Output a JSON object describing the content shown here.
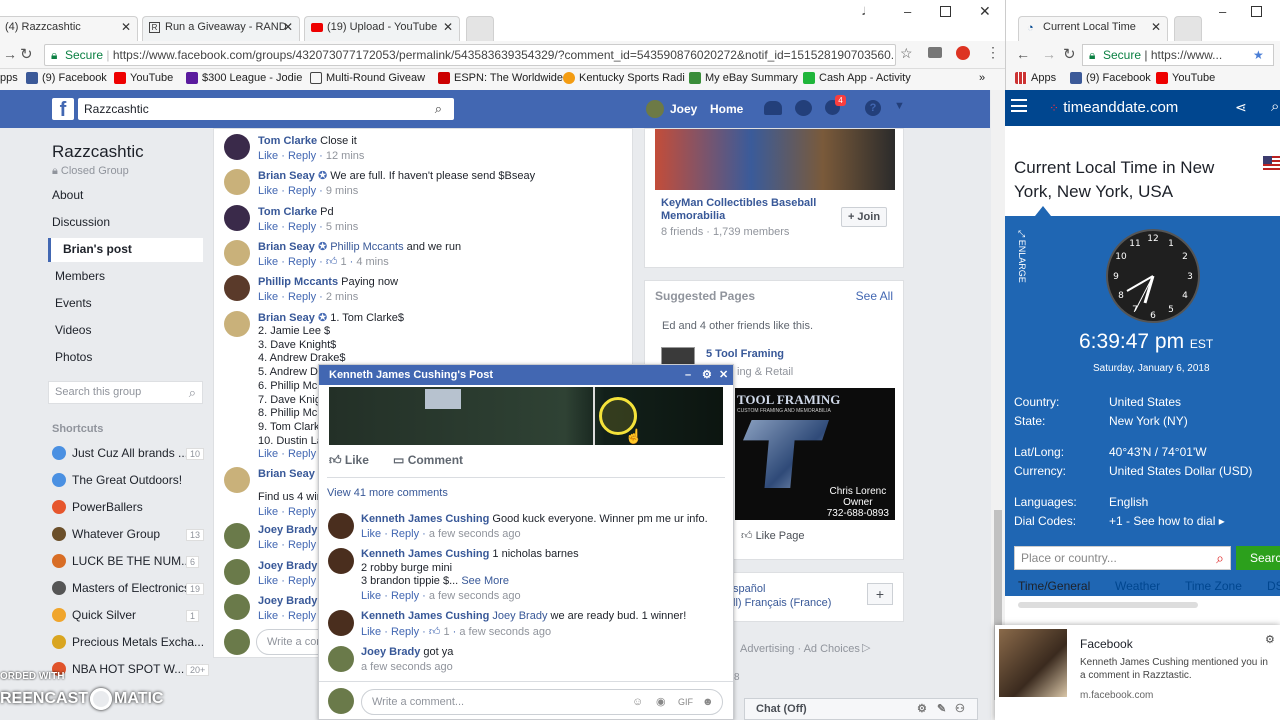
{
  "left_browser": {
    "tabs": [
      {
        "title": "(4) Razzcashtic",
        "active": true
      },
      {
        "title": "Run a Giveaway - RAND"
      },
      {
        "title": "(19) Upload - YouTube"
      }
    ],
    "url_secure": "Secure",
    "url": "https://www.facebook.com/groups/432073077172053/permalink/543583639354329/?comment_id=543590876020272&notif_id=151528190703560...",
    "bookmarks": [
      "pps",
      "(9) Facebook",
      "YouTube",
      "$300 League - Jodie",
      "Multi-Round Giveaw",
      "ESPN: The Worldwide",
      "Kentucky Sports Radi",
      "My eBay Summary",
      "Cash App - Activity"
    ],
    "more": "»"
  },
  "fb": {
    "search_value": "Razzcashtic",
    "user": "Joey",
    "home": "Home",
    "notif_count": "4",
    "group_name": "Razzcashtic",
    "group_type": "Closed Group",
    "nav": [
      "About",
      "Discussion",
      "Brian's post",
      "Members",
      "Events",
      "Videos",
      "Photos"
    ],
    "search_group_placeholder": "Search this group",
    "shortcuts_title": "Shortcuts",
    "shortcuts": [
      {
        "label": "Just Cuz All brands ...",
        "count": "10",
        "color": "#4a90e2"
      },
      {
        "label": "The Great Outdoors!",
        "count": "",
        "color": "#4a90e2"
      },
      {
        "label": "PowerBallers",
        "count": "",
        "color": "#e6562d"
      },
      {
        "label": "Whatever Group",
        "count": "13",
        "color": "#6b4f2a"
      },
      {
        "label": "LUCK BE THE NUM...",
        "count": "6",
        "color": "#d86d25"
      },
      {
        "label": "Masters of Electronics",
        "count": "19",
        "color": "#555555"
      },
      {
        "label": "Quick Silver",
        "count": "1",
        "color": "#f0a52c"
      },
      {
        "label": "Precious Metals Excha...",
        "count": "",
        "color": "#d9a520"
      },
      {
        "label": "NBA HOT SPOT W...",
        "count": "20+",
        "color": "#e0532b"
      }
    ],
    "comments": [
      {
        "name": "Tom Clarke",
        "text": "Close it",
        "time": "12 mins"
      },
      {
        "name": "Brian Seay",
        "verified": true,
        "text": "We are full. If haven't please send $Bseay",
        "time": "9 mins"
      },
      {
        "name": "Tom Clarke",
        "text": "Pd",
        "time": "5 mins"
      },
      {
        "name": "Brian Seay",
        "verified": true,
        "tag": "Phillip Mccants",
        "text": "and we run",
        "likes": "1",
        "time": "4 mins"
      },
      {
        "name": "Phillip Mccants",
        "text": "Paying now",
        "time": "2 mins"
      },
      {
        "name": "Brian Seay",
        "verified": true,
        "text": "1. Tom Clarke$"
      }
    ],
    "list_lines": [
      "2. Jamie Lee $",
      "3. Dave Knight$",
      "4. Andrew Drake$",
      "5. Andrew Dr",
      "6. Phillip Mc",
      "7. Dave Knigh",
      "8. Phillip Mc",
      "9. Tom Clarke",
      "10. Dustin La"
    ],
    "brian2_name": "Brian Seay",
    "brian2_text": "Find us 4 win",
    "joey_names": [
      "Joey Brady",
      "Joey Brady",
      "Joey Brady"
    ],
    "like": "Like",
    "reply": "Reply",
    "write_comment": "Write a com",
    "right_group": {
      "name": "KeyMan Collectibles Baseball Memorabilia",
      "stats": "8 friends · 1,739 members",
      "join": "+ Join"
    },
    "suggested": {
      "title": "Suggested Pages",
      "see_all": "See All",
      "friends_line": "Ed and 4 other friends like this.",
      "page": "5 Tool Framing",
      "category": "ing & Retail",
      "banner_title": "TOOL FRAMING",
      "banner_sub": "CUSTOM FRAMING AND MEMORABILIA",
      "owner": "Chris Lorenc",
      "owner_title": "Owner",
      "phone": "732-688-0893",
      "like_page": "Like Page"
    },
    "lang1": "spañol",
    "lang2": "ll)   Français (France)",
    "plus": "+",
    "footer": "Advertising · Ad Choices",
    "chat_off": "Chat (Off)"
  },
  "popup": {
    "title": "Kenneth James Cushing's Post",
    "like": "Like",
    "comment": "Comment",
    "view_more": "View 41 more comments",
    "comments": [
      {
        "name": "Kenneth James Cushing",
        "text": "Good kuck everyone. Winner pm me ur info.",
        "time": "a few seconds ago"
      },
      {
        "name": "Kenneth James Cushing",
        "text": "1 nicholas barnes",
        "line2": "2 robby burge mini",
        "line3": "3 brandon tippie $...",
        "see_more": "See More",
        "time": "a few seconds ago"
      },
      {
        "name": "Kenneth James Cushing",
        "tag": "Joey Brady",
        "text": "we are ready bud. 1 winner!",
        "likes": "1",
        "time": "a few seconds ago"
      },
      {
        "name": "Joey Brady",
        "text": "got ya",
        "time": "a few seconds ago"
      }
    ],
    "write_placeholder": "Write a comment..."
  },
  "watermark": {
    "line1": "ORDED WITH",
    "line2": "REENCAST",
    "line3": "MATIC"
  },
  "right_browser": {
    "tab": "Current Local Time",
    "url_secure": "Secure",
    "url": "https://www...",
    "bookmarks": [
      "Apps",
      "(9) Facebook",
      "YouTube"
    ],
    "site": "timeanddate.com",
    "heading": "Current Local Time in New York, New York, USA",
    "enlarge": "ENLARGE",
    "time": "6:39:47 pm",
    "tz": "EST",
    "date": "Saturday, January 6, 2018",
    "rows": [
      {
        "k": "Country:",
        "v": "United States"
      },
      {
        "k": "State:",
        "v": "New York (NY)"
      },
      {
        "k": "Lat/Long:",
        "v": "40°43'N / 74°01'W"
      },
      {
        "k": "Currency:",
        "v": "United States Dollar (USD)"
      },
      {
        "k": "Languages:",
        "v": "English"
      },
      {
        "k": "Dial Codes:",
        "v": "+1 - See how to dial ▸"
      }
    ],
    "search_placeholder": "Place or country...",
    "search_btn": "Search",
    "tabs": [
      "Time/General",
      "Weather",
      "Time Zone",
      "DS"
    ]
  },
  "notification": {
    "app": "Facebook",
    "text": "Kenneth James Cushing mentioned you in a comment in Razztastic.",
    "source": "m.facebook.com"
  }
}
